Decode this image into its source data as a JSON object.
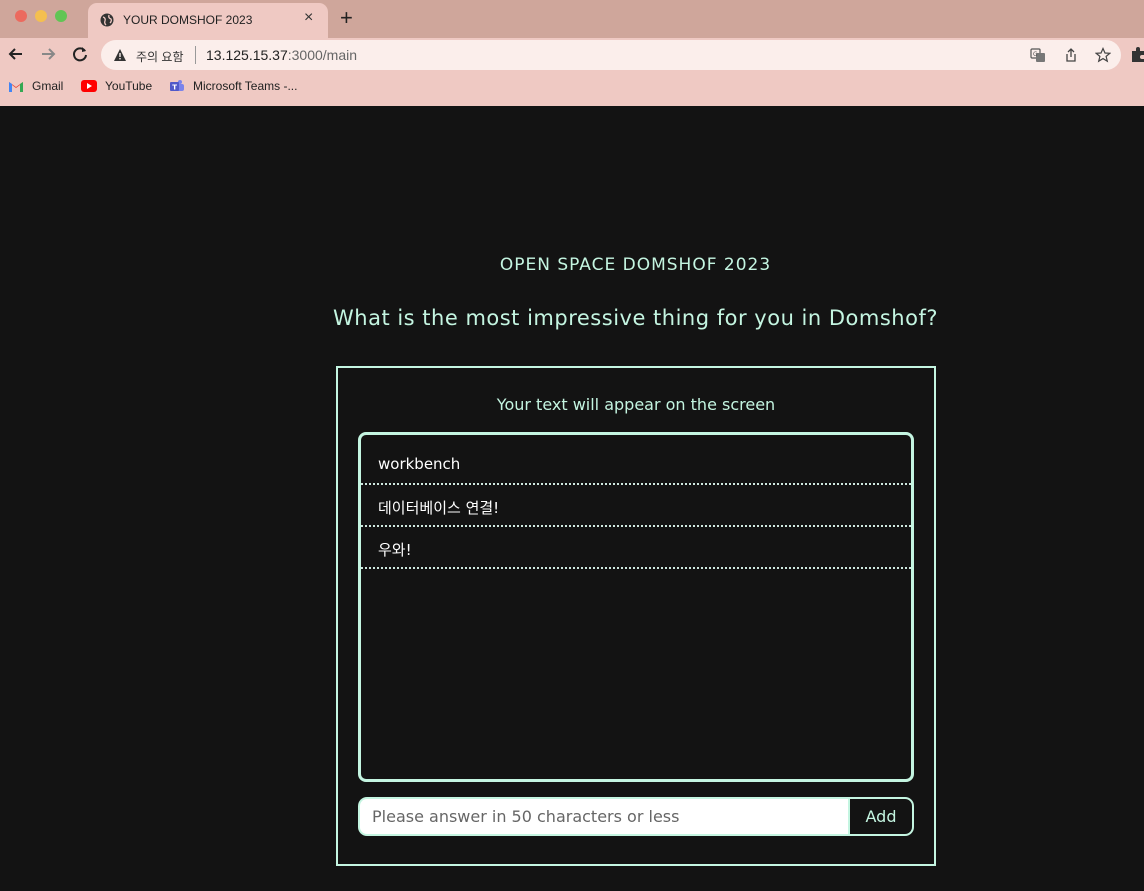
{
  "browser": {
    "tab_title": "YOUR DOMSHOF 2023",
    "new_tab_symbol": "+",
    "close_symbol": "×",
    "security_label": "주의 요함",
    "url_host": "13.125.15.37",
    "url_rest": ":3000/main",
    "bookmarks": [
      {
        "label": "Gmail",
        "icon": "gmail-icon"
      },
      {
        "label": "YouTube",
        "icon": "youtube-icon"
      },
      {
        "label": "Microsoft Teams -...",
        "icon": "teams-icon"
      }
    ]
  },
  "page": {
    "event_title": "OPEN SPACE DOMSHOF 2023",
    "question": "What is the most impressive thing for you in Domshof?",
    "panel_subtitle": "Your text will appear on the screen",
    "answers": [
      "workbench",
      "데이터베이스 연결!",
      "우와!"
    ],
    "input_placeholder": "Please answer in 50 characters or less",
    "add_label": "Add"
  },
  "colors": {
    "accent": "#c4f5e1",
    "background": "#131313",
    "chrome": "#efc9c3",
    "tabbar": "#cfa69b"
  }
}
